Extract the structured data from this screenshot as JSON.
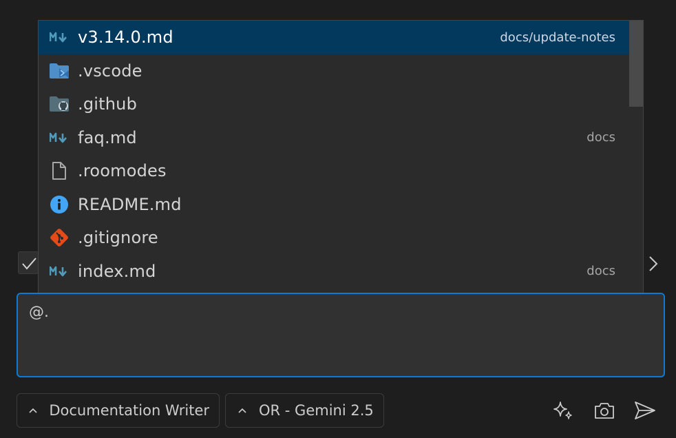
{
  "autocomplete": {
    "items": [
      {
        "name": "v3.14.0.md",
        "path": "docs/update-notes",
        "icon": "markdown-icon",
        "selected": true
      },
      {
        "name": ".vscode",
        "path": "",
        "icon": "vscode-folder-icon",
        "selected": false
      },
      {
        "name": ".github",
        "path": "",
        "icon": "github-folder-icon",
        "selected": false
      },
      {
        "name": "faq.md",
        "path": "docs",
        "icon": "markdown-icon",
        "selected": false
      },
      {
        "name": ".roomodes",
        "path": "",
        "icon": "file-icon",
        "selected": false
      },
      {
        "name": "README.md",
        "path": "",
        "icon": "info-icon",
        "selected": false
      },
      {
        "name": ".gitignore",
        "path": "",
        "icon": "git-icon",
        "selected": false
      },
      {
        "name": "index.md",
        "path": "docs",
        "icon": "markdown-icon",
        "selected": false
      }
    ],
    "scroll_position": 0.0
  },
  "chat": {
    "input_value": "@."
  },
  "toolbar": {
    "mode_label": "Documentation Writer",
    "model_label": "OR - Gemini 2.5"
  },
  "colors": {
    "background": "#1e1e1e",
    "popup_background": "#2b2b2b",
    "selection": "#04395e",
    "focus_border": "#0e7ad3",
    "markdown_icon": "#519aba",
    "git_icon": "#e64a19",
    "info_icon": "#42a5f5"
  }
}
